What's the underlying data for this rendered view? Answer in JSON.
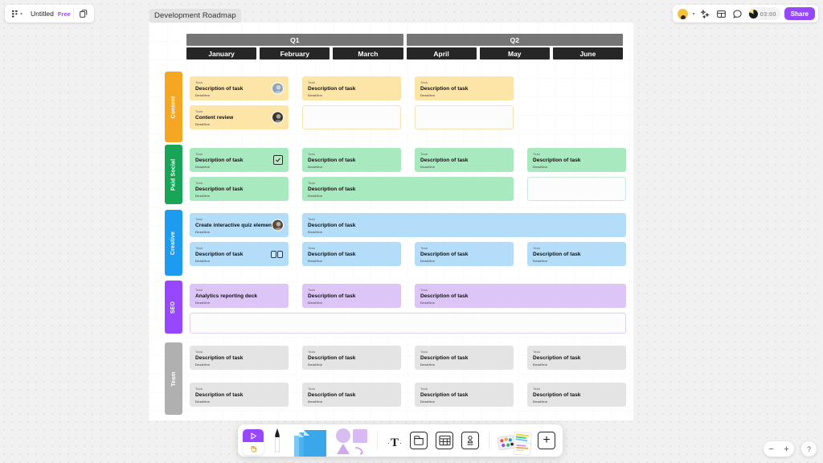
{
  "app": {
    "file_name": "Untitled",
    "plan_badge": "Free",
    "logo_icon": "figjam-logo-icon",
    "menu_caret_icon": "chevron-down-icon",
    "duplicate_icon": "duplicate-file-icon"
  },
  "topbar_right": {
    "avatar_icon": "user-avatar-icon",
    "avatar_caret_icon": "chevron-down-icon",
    "buttons": [
      {
        "name": "reactions-icon",
        "glyph": "reactions-sparkle-icon"
      },
      {
        "name": "layout-grid-icon",
        "glyph": "panel-layout-icon"
      },
      {
        "name": "comment-icon",
        "glyph": "speech-bubble-icon"
      }
    ],
    "timer": {
      "value": "03:00",
      "dial_icon": "timer-dial-icon"
    },
    "share_label": "Share"
  },
  "frame": {
    "label": "Development Roadmap"
  },
  "timeline": {
    "quarters": [
      {
        "label": "Q1",
        "span": 3
      },
      {
        "label": "Q2",
        "span": 3
      }
    ],
    "months": [
      "January",
      "February",
      "March",
      "April",
      "May",
      "June"
    ]
  },
  "lanes": [
    {
      "label": "Content",
      "color": "#f5a623",
      "card_color": "#fde5a8",
      "slot_border": "#f3e3b4",
      "cards": [
        {
          "task": "Task",
          "title": "Description of task",
          "deadline": "Deadline",
          "avatar": "avatar-photo-1",
          "avatar_color": "#8fa3b8"
        },
        {
          "task": "Task",
          "title": "Content review",
          "deadline": "Deadline",
          "avatar": "avatar-photo-2",
          "avatar_color": "#3c3630"
        },
        {
          "task": "Task",
          "title": "Description of task",
          "deadline": "Deadline"
        },
        {
          "task": "Task",
          "title": "Description of task",
          "deadline": "Deadline"
        }
      ]
    },
    {
      "label": "Paid Social",
      "color": "#18a558",
      "card_color": "#a8e9bf",
      "slot_border": "#c9e8d6",
      "cards": [
        {
          "task": "Task",
          "title": "Description of task",
          "deadline": "Deadline",
          "badge": "checkbox-sticker-icon"
        },
        {
          "task": "Task",
          "title": "Description of task",
          "deadline": "Deadline"
        },
        {
          "task": "Task",
          "title": "Description of task",
          "deadline": "Deadline"
        },
        {
          "task": "Task",
          "title": "Description of task",
          "deadline": "Deadline"
        },
        {
          "task": "Task",
          "title": "Description of task",
          "deadline": "Deadline"
        },
        {
          "task": "Task",
          "title": "Description of task",
          "deadline": "Deadline"
        }
      ]
    },
    {
      "label": "Creative",
      "color": "#1d9bf0",
      "card_color": "#b3ddf8",
      "slot_border": "#cfe6fb",
      "cards": [
        {
          "task": "Task",
          "title": "Create interactive quiz element",
          "deadline": "Deadline",
          "avatar": "avatar-photo-3",
          "avatar_color": "#5a4a3a"
        },
        {
          "task": "Task",
          "title": "Description of task",
          "deadline": "Deadline"
        },
        {
          "task": "Task",
          "title": "Description of task",
          "deadline": "Deadline",
          "badge": "goggles-sticker-icon"
        },
        {
          "task": "Task",
          "title": "Description of task",
          "deadline": "Deadline"
        },
        {
          "task": "Task",
          "title": "Description of task",
          "deadline": "Deadline"
        },
        {
          "task": "Task",
          "title": "Description of task",
          "deadline": "Deadline"
        }
      ]
    },
    {
      "label": "SEO",
      "color": "#9747ff",
      "card_color": "#ddc6f7",
      "slot_border": "#ddd0ee",
      "cards": [
        {
          "task": "Task",
          "title": "Analytics reporting deck",
          "deadline": "Deadline"
        },
        {
          "task": "Task",
          "title": "Description of task",
          "deadline": "Deadline"
        },
        {
          "task": "Task",
          "title": "Description of task",
          "deadline": "Deadline"
        }
      ]
    },
    {
      "label": "Team",
      "color": "#b0b0b0",
      "card_color": "#e4e4e4",
      "slot_border": "#ededed",
      "cards": [
        {
          "task": "Task",
          "title": "Description of task",
          "deadline": "Deadline"
        },
        {
          "task": "Task",
          "title": "Description of task",
          "deadline": "Deadline"
        },
        {
          "task": "Task",
          "title": "Description of task",
          "deadline": "Deadline"
        },
        {
          "task": "Task",
          "title": "Description of task",
          "deadline": "Deadline"
        },
        {
          "task": "Task",
          "title": "Description of task",
          "deadline": "Deadline"
        },
        {
          "task": "Task",
          "title": "Description of task",
          "deadline": "Deadline"
        },
        {
          "task": "Task",
          "title": "Description of task",
          "deadline": "Deadline"
        },
        {
          "task": "Task",
          "title": "Description of task",
          "deadline": "Deadline"
        }
      ]
    }
  ],
  "toolbar": {
    "items": [
      {
        "name": "cursor-hand-tool",
        "glyph": "cursor-arrow-icon"
      },
      {
        "name": "pen-tool",
        "glyph": "marker-pen-icon"
      },
      {
        "name": "sticky-note-tool",
        "glyph": "sticky-notes-icon"
      },
      {
        "name": "shapes-tool",
        "glyph": "shapes-icon"
      },
      {
        "name": "text-tool",
        "glyph": "text-T-icon"
      },
      {
        "name": "section-tool",
        "glyph": "frame-section-icon"
      },
      {
        "name": "table-tool",
        "glyph": "table-grid-icon"
      },
      {
        "name": "stamp-tool",
        "glyph": "stamp-icon"
      },
      {
        "name": "widgets-tool",
        "glyph": "widgets-media-icon"
      },
      {
        "name": "add-more-tool",
        "glyph": "plus-icon"
      }
    ]
  },
  "zoom_controls": {
    "zoom_out": "−",
    "zoom_in": "+",
    "help": "?"
  }
}
